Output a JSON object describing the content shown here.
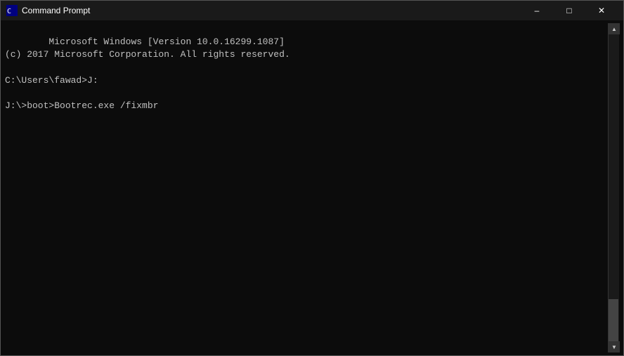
{
  "window": {
    "title": "Command Prompt",
    "icon": "cmd-icon"
  },
  "titlebar": {
    "minimize_label": "–",
    "maximize_label": "□",
    "close_label": "✕"
  },
  "console": {
    "line1": "Microsoft Windows [Version 10.0.16299.1087]",
    "line2": "(c) 2017 Microsoft Corporation. All rights reserved.",
    "line3": "",
    "line4": "C:\\Users\\fawad>J:",
    "line5": "",
    "line6": "J:\\>boot>Bootrec.exe /fixmbr"
  }
}
